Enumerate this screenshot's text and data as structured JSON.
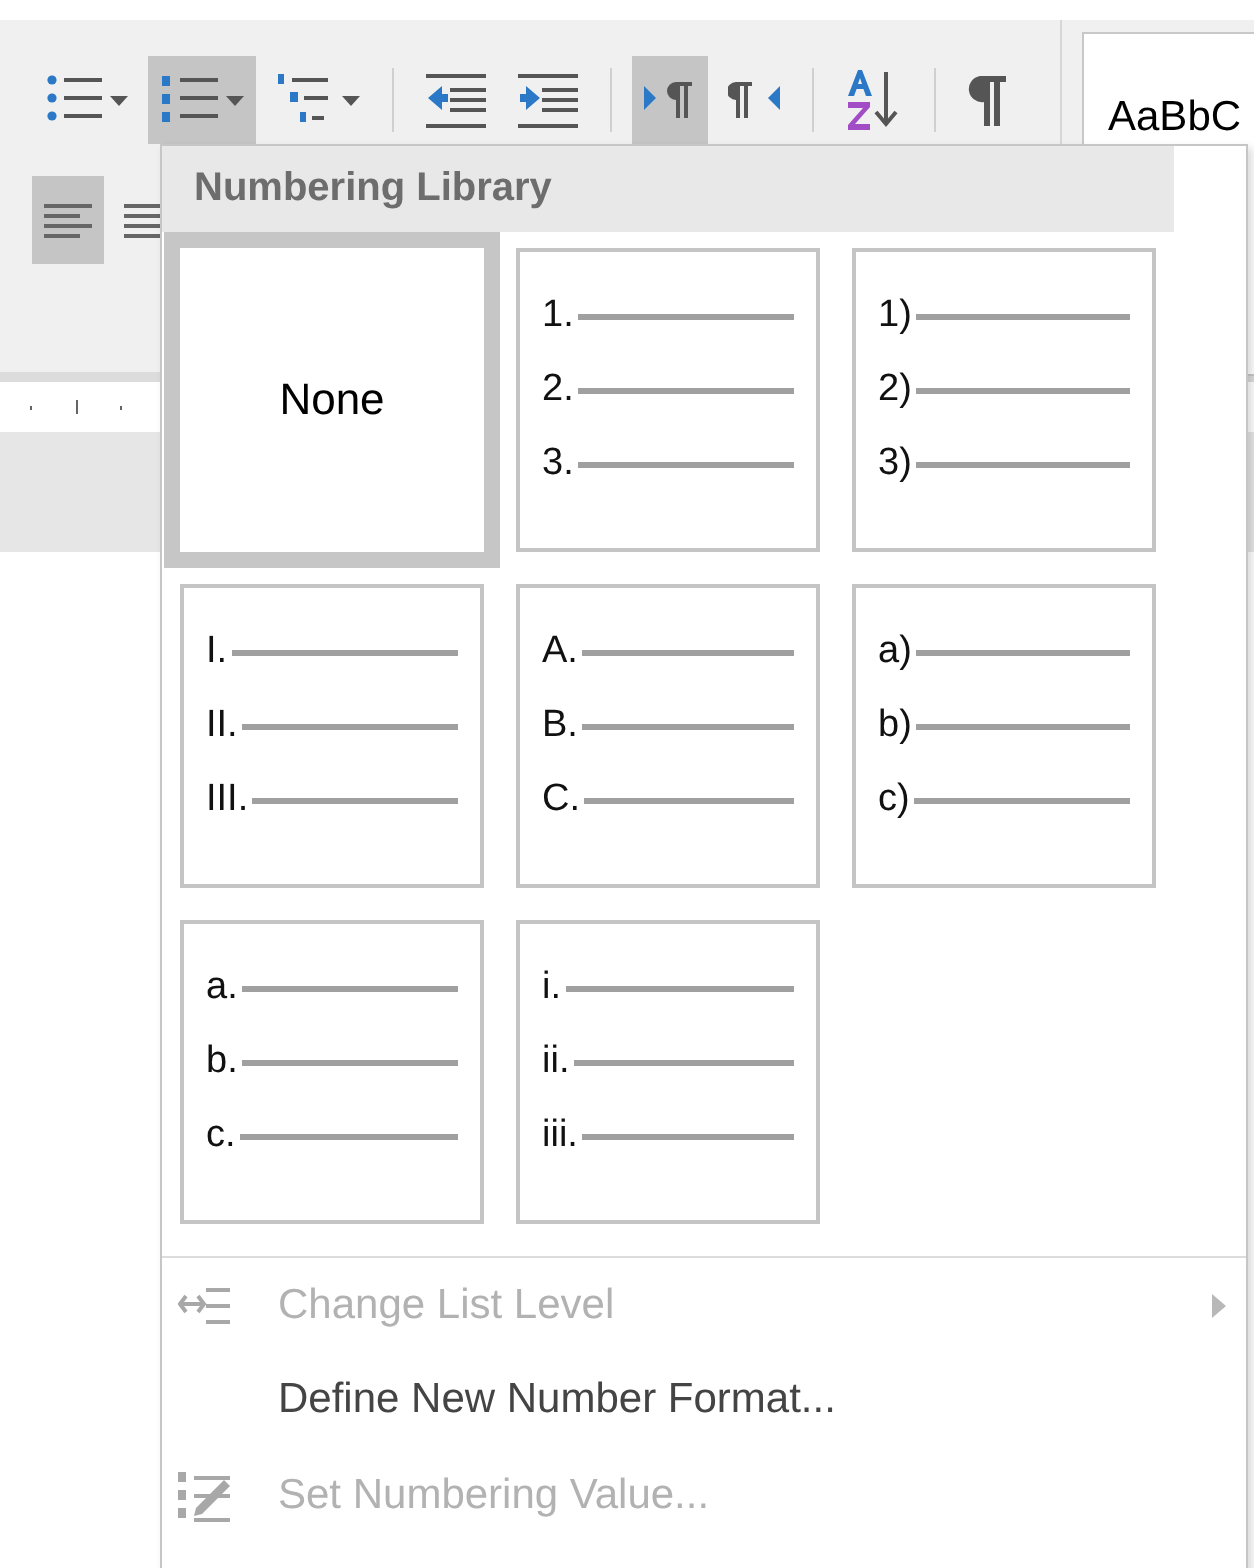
{
  "ribbon": {
    "row1": [
      {
        "kind": "bullets",
        "selected": false,
        "caret": true
      },
      {
        "kind": "numbering",
        "selected": true,
        "caret": true
      },
      {
        "kind": "multilevel",
        "selected": false,
        "caret": true
      },
      {
        "kind": "separator"
      },
      {
        "kind": "decrease_indent",
        "selected": false,
        "caret": false
      },
      {
        "kind": "increase_indent",
        "selected": false,
        "caret": false
      },
      {
        "kind": "separator"
      },
      {
        "kind": "ltr",
        "selected": true,
        "caret": false
      },
      {
        "kind": "rtl",
        "selected": false,
        "caret": false
      },
      {
        "kind": "separator"
      },
      {
        "kind": "sort",
        "selected": false,
        "caret": false
      },
      {
        "kind": "separator"
      },
      {
        "kind": "pilcrow",
        "selected": false,
        "caret": false
      }
    ],
    "style_preview": "AaBbC",
    "row2": [
      {
        "kind": "align_left",
        "selected": true
      },
      {
        "kind": "align_center",
        "selected": false
      }
    ]
  },
  "numbering_library": {
    "title": "Numbering Library",
    "tiles": [
      {
        "kind": "none",
        "label": "None",
        "selected": true
      },
      {
        "kind": "list",
        "markers": [
          "1.",
          "2.",
          "3."
        ],
        "selected": false
      },
      {
        "kind": "list",
        "markers": [
          "1)",
          "2)",
          "3)"
        ],
        "selected": false
      },
      {
        "kind": "list",
        "markers": [
          "I.",
          "II.",
          "III."
        ],
        "selected": false
      },
      {
        "kind": "list",
        "markers": [
          "A.",
          "B.",
          "C."
        ],
        "selected": false
      },
      {
        "kind": "list",
        "markers": [
          "a)",
          "b)",
          "c)"
        ],
        "selected": false
      },
      {
        "kind": "list",
        "markers": [
          "a.",
          "b.",
          "c."
        ],
        "selected": false
      },
      {
        "kind": "list",
        "markers": [
          "i.",
          "ii.",
          "iii."
        ],
        "selected": false
      }
    ],
    "menu": [
      {
        "kind": "list_level",
        "label": "Change List Level",
        "disabled": true,
        "submenu": true
      },
      {
        "kind": "plain",
        "label": "Define New Number Format...",
        "disabled": false,
        "submenu": false
      },
      {
        "kind": "set_value",
        "label": "Set Numbering Value...",
        "disabled": true,
        "submenu": false
      }
    ]
  }
}
